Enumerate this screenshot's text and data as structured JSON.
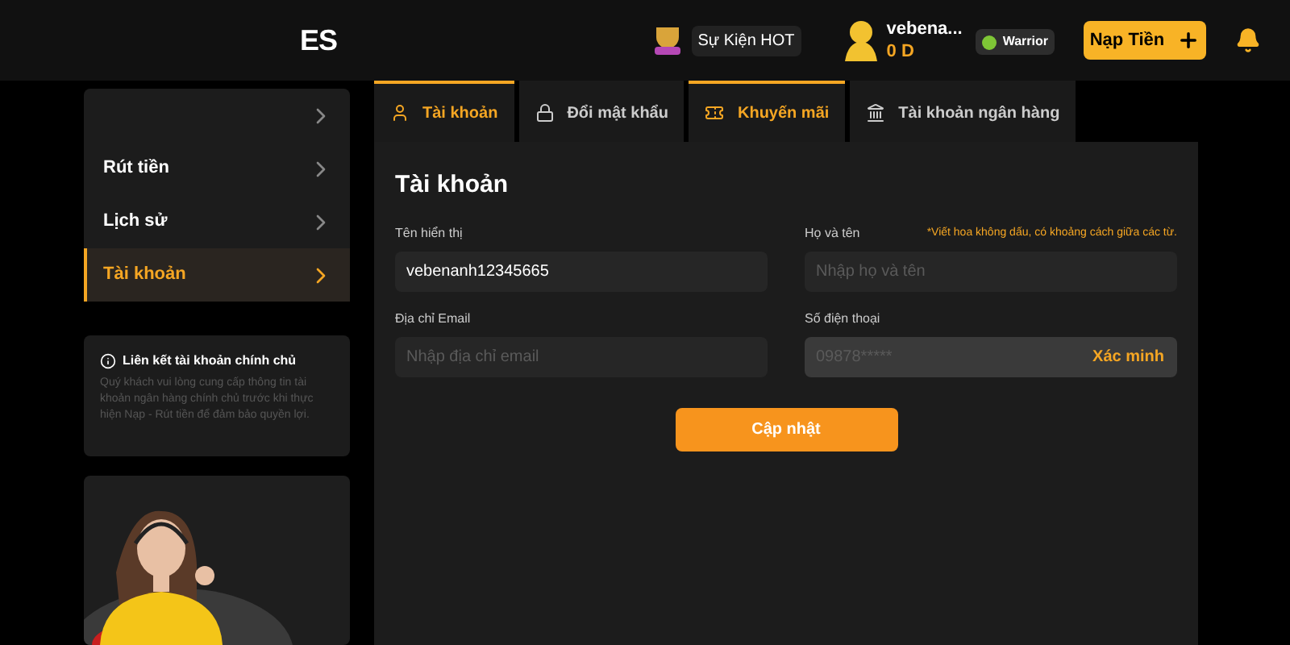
{
  "header": {
    "logo_fragment": "ES",
    "event": {
      "label": "Sự Kiện HOT"
    },
    "user": {
      "name": "vebena...",
      "balance": "0 D",
      "rank": "Warrior"
    },
    "deposit_button": "Nạp Tiền"
  },
  "sidebar": {
    "items": [
      {
        "selected": false
      },
      {
        "label": "Rút tiền",
        "selected": false
      },
      {
        "label": "Lịch sử",
        "selected": false
      },
      {
        "label": "Tài khoản",
        "selected": true
      }
    ],
    "info": {
      "title": "Liên kết tài khoản chính chủ",
      "text": "Quý khách vui lòng cung cấp thông tin tài khoản ngân hàng chính chủ trước khi thực hiện Nạp - Rút tiền để đảm bảo quyền lợi."
    }
  },
  "tabs": [
    {
      "label": "Tài khoản",
      "kind": "user",
      "selected": true
    },
    {
      "label": "Đổi mật khẩu",
      "kind": "lock",
      "selected": false
    },
    {
      "label": "Khuyến mãi",
      "kind": "ticket",
      "selected": true
    },
    {
      "label": "Tài khoản ngân hàng",
      "kind": "bank",
      "selected": false
    }
  ],
  "form": {
    "title": "Tài khoản",
    "note": "*Viết hoa không dấu, có khoảng cách giữa các từ.",
    "fields": [
      {
        "label": "Tên hiển thị",
        "value": "vebenanh12345665"
      },
      {
        "label": "Họ và tên",
        "placeholder": "Nhập họ và tên"
      },
      {
        "label": "Địa chỉ Email",
        "placeholder": "Nhập địa chỉ email"
      },
      {
        "label": "Số điện thoại",
        "placeholder": "09878*****",
        "action": "Xác minh",
        "disabled": true
      }
    ],
    "submit": "Cập nhật"
  }
}
